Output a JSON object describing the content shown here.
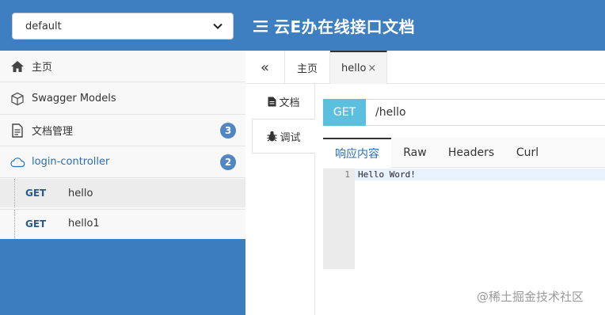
{
  "header": {
    "group_selected": "default",
    "brand_title": "云E办在线接口文档"
  },
  "sidebar": {
    "items": [
      {
        "label": "主页",
        "icon": "home-icon"
      },
      {
        "label": "Swagger Models",
        "icon": "cube-icon"
      },
      {
        "label": "文档管理",
        "icon": "document-icon",
        "badge": "3"
      },
      {
        "label": "login-controller",
        "icon": "cloud-api-icon",
        "badge": "2"
      }
    ],
    "apis": [
      {
        "method": "GET",
        "path": "hello"
      },
      {
        "method": "GET",
        "path": "hello1"
      }
    ]
  },
  "tabs": {
    "collapse": "«",
    "home": "主页",
    "active": "hello",
    "close": "×"
  },
  "vtabs": {
    "doc": "文档",
    "debug": "调试"
  },
  "request": {
    "method": "GET",
    "url": "/hello"
  },
  "response_tabs": [
    "响应内容",
    "Raw",
    "Headers",
    "Curl"
  ],
  "editor": {
    "line_number": "1",
    "content": "Hello Word!"
  },
  "watermark": "@稀土掘金技术社区",
  "colors": {
    "header_bg": "#3d7fc0",
    "sidebar_bg": "#3b7dbf",
    "badge_bg": "#5086c2",
    "get_bg": "#5bc0de",
    "active_text": "#2a6db5"
  }
}
